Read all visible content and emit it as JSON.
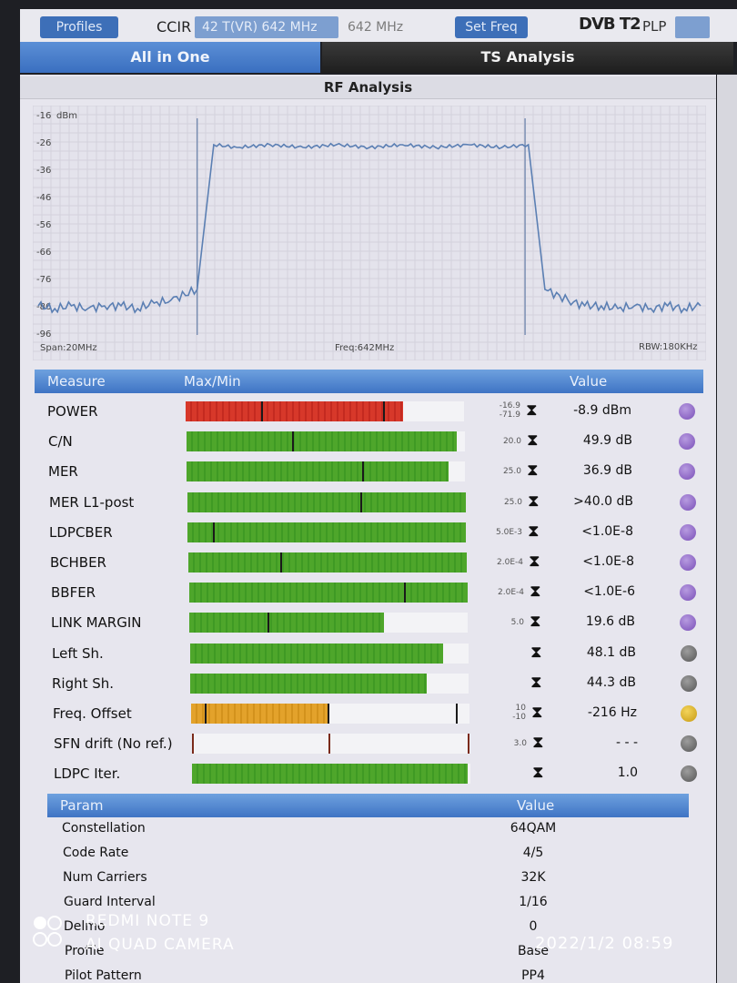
{
  "topbar": {
    "profiles_label": "Profiles",
    "standard": "CCIR",
    "channel": "42 T(VR) 642 MHz",
    "frequency": "642 MHz",
    "setfreq_label": "Set Freq",
    "dvb_logo": "DVB T2",
    "plp_label": "PLP"
  },
  "tabs": {
    "all_in_one": "All in One",
    "ts_analysis": "TS Analysis"
  },
  "rf": {
    "title": "RF Analysis",
    "unit": "dBm",
    "y_ticks": [
      "-16",
      "-26",
      "-36",
      "-46",
      "-56",
      "-66",
      "-76",
      "-86",
      "-96"
    ],
    "span": "Span:20MHz",
    "freq": "Freq:642MHz",
    "rbw": "RBW:180KHz"
  },
  "chart_data": {
    "type": "line",
    "ylim": [
      -96,
      -16
    ],
    "xlim": [
      632,
      652
    ],
    "ylabel": "dBm",
    "grid": true,
    "series": [
      {
        "x": [
          632,
          632.5,
          633,
          633.5,
          634,
          634.5,
          635,
          635.5,
          636,
          636.8,
          637.3,
          638,
          639,
          640,
          641,
          642,
          643,
          644,
          645,
          646,
          646.8,
          647.3,
          648,
          648.5,
          649,
          649.5,
          650,
          650.5,
          651,
          651.5,
          652
        ],
        "values": [
          -86,
          -87,
          -86,
          -87,
          -86,
          -86,
          -87,
          -85,
          -84,
          -80,
          -27,
          -28,
          -27,
          -28,
          -27,
          -28,
          -27,
          -28,
          -27,
          -28,
          -27,
          -80,
          -84,
          -86,
          -86,
          -87,
          -86,
          -87,
          -86,
          -87,
          -86
        ]
      }
    ]
  },
  "measure": {
    "hdr_measure": "Measure",
    "hdr_maxmin": "Max/Min",
    "hdr_value": "Value",
    "rows": [
      {
        "name": "POWER",
        "thr": "-16.9",
        "thr2": "-71.9",
        "value": "-8.9 dBm",
        "fill": 0.78,
        "color": "r",
        "marks": [
          0.27,
          0.71
        ],
        "dot": "purple"
      },
      {
        "name": "C/N",
        "thr": "20.0",
        "thr2": "",
        "value": "49.9 dB",
        "fill": 0.97,
        "color": "g",
        "marks": [
          0.38
        ],
        "dot": "purple"
      },
      {
        "name": "MER",
        "thr": "25.0",
        "thr2": "",
        "value": "36.9 dB",
        "fill": 0.94,
        "color": "g",
        "marks": [
          0.63
        ],
        "dot": "purple"
      },
      {
        "name": "MER L1-post",
        "thr": "25.0",
        "thr2": "",
        "value": ">40.0 dB",
        "fill": 1.0,
        "color": "g",
        "marks": [
          0.62
        ],
        "dot": "purple"
      },
      {
        "name": "LDPCBER",
        "thr": "5.0E-3",
        "thr2": "",
        "value": "<1.0E-8",
        "fill": 1.0,
        "color": "g",
        "marks": [
          0.09
        ],
        "dot": "purple"
      },
      {
        "name": "BCHBER",
        "thr": "2.0E-4",
        "thr2": "",
        "value": "<1.0E-8",
        "fill": 1.0,
        "color": "g",
        "marks": [
          0.33
        ],
        "dot": "purple"
      },
      {
        "name": "BBFER",
        "thr": "2.0E-4",
        "thr2": "",
        "value": "<1.0E-6",
        "fill": 1.0,
        "color": "g",
        "marks": [
          0.77
        ],
        "dot": "purple"
      },
      {
        "name": "LINK MARGIN",
        "thr": "5.0",
        "thr2": "",
        "value": "19.6 dB",
        "fill": 0.7,
        "color": "g",
        "marks": [
          0.28
        ],
        "dot": "purple"
      },
      {
        "name": "Left Sh.",
        "thr": "",
        "thr2": "",
        "value": "48.1 dB",
        "fill": 0.91,
        "color": "g",
        "marks": [],
        "dot": "gray"
      },
      {
        "name": "Right Sh.",
        "thr": "",
        "thr2": "",
        "value": "44.3 dB",
        "fill": 0.85,
        "color": "g",
        "marks": [],
        "dot": "gray"
      },
      {
        "name": "Freq. Offset",
        "thr": "10",
        "thr2": "-10",
        "value": "-216 Hz",
        "fill": 0.49,
        "color": "o",
        "marks": [
          0.05,
          0.49,
          0.95
        ],
        "dot": "yellow"
      },
      {
        "name": "SFN drift (No ref.)",
        "thr": "3.0",
        "thr2": "",
        "value": "- - -",
        "fill": 0,
        "color": "g",
        "marks": [
          0.0,
          0.49,
          0.99
        ],
        "dot": "gray"
      },
      {
        "name": "LDPC Iter.",
        "thr": "",
        "thr2": "",
        "value": "1.0",
        "fill": 0.99,
        "color": "g",
        "marks": [],
        "dot": "gray"
      }
    ]
  },
  "params": {
    "hdr_param": "Param",
    "hdr_value": "Value",
    "rows": [
      {
        "name": "Constellation",
        "value": "64QAM"
      },
      {
        "name": "Code Rate",
        "value": "4/5"
      },
      {
        "name": "Num Carriers",
        "value": "32K"
      },
      {
        "name": "Guard Interval",
        "value": "1/16"
      },
      {
        "name": "Delmo",
        "value": "0"
      },
      {
        "name": "Profile",
        "value": "Base"
      },
      {
        "name": "Pilot Pattern",
        "value": "PP4"
      }
    ]
  },
  "overlay": {
    "camera_line1": "REDMI NOTE 9",
    "camera_line2": "AI QUAD CAMERA",
    "timestamp": "2022/1/2 08:59"
  }
}
